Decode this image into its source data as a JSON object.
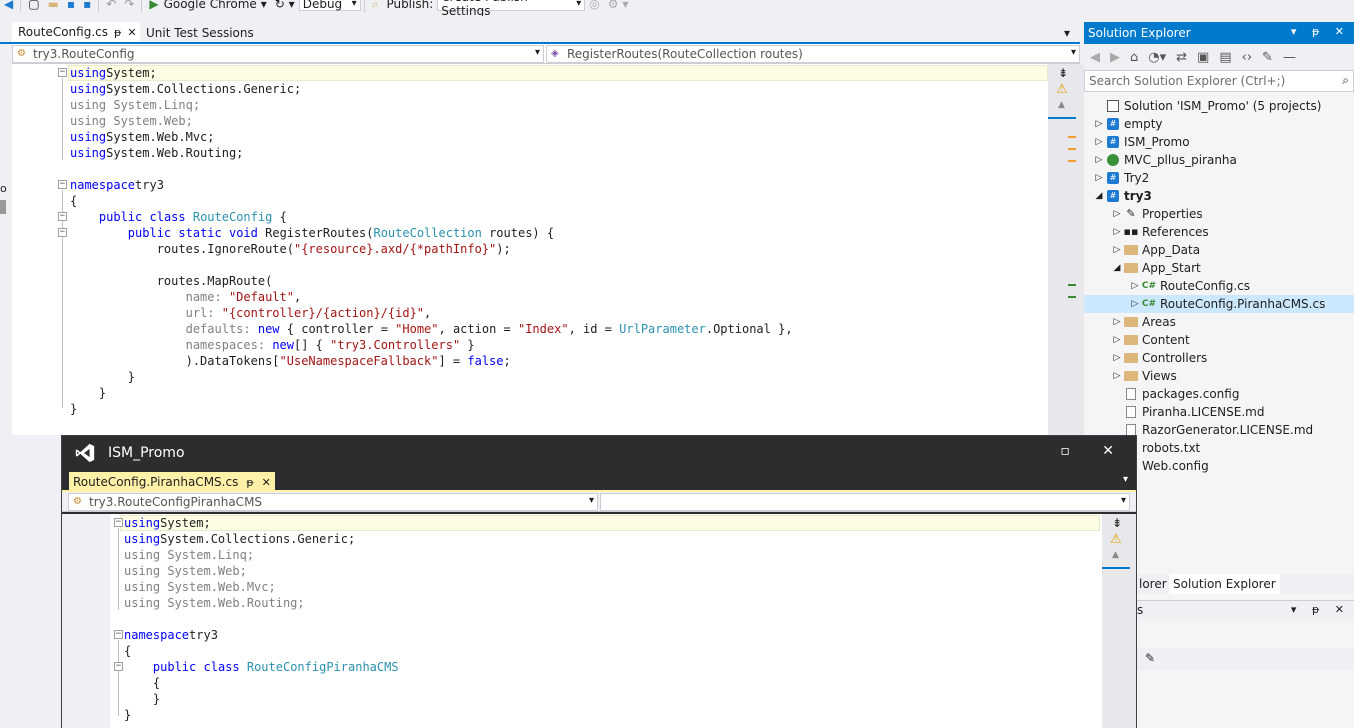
{
  "toolbar": {
    "run_target": "Google Chrome",
    "configuration": "Debug",
    "publish_label": "Publish:",
    "publish_setting": "Create Publish Settings"
  },
  "main_tabs": [
    {
      "label": "RouteConfig.cs",
      "active": true
    },
    {
      "label": "Unit Test Sessions",
      "active": false
    }
  ],
  "main_nav": {
    "class_combo": "try3.RouteConfig",
    "member_combo": "RegisterRoutes(RouteCollection routes)"
  },
  "main_code": [
    [
      [
        "kw",
        "using"
      ],
      [
        "",
        "System;"
      ]
    ],
    [
      [
        "kw",
        "using"
      ],
      [
        "",
        "System.Collections.Generic;"
      ]
    ],
    [
      [
        "gr",
        "using System.Linq;"
      ]
    ],
    [
      [
        "gr",
        "using System.Web;"
      ]
    ],
    [
      [
        "kw",
        "using"
      ],
      [
        "",
        "System.Web.Mvc;"
      ]
    ],
    [
      [
        "kw",
        "using"
      ],
      [
        "",
        "System.Web.Routing;"
      ]
    ],
    [],
    [
      [
        "kw",
        "namespace"
      ],
      [
        "",
        "try3"
      ]
    ],
    [
      [
        "",
        "{"
      ]
    ],
    [
      [
        "",
        "    "
      ],
      [
        "kw",
        "public"
      ],
      [
        "",
        " "
      ],
      [
        "kw",
        "class"
      ],
      [
        "",
        " "
      ],
      [
        "ty",
        "RouteConfig"
      ],
      [
        "",
        " {"
      ]
    ],
    [
      [
        "",
        "        "
      ],
      [
        "kw",
        "public"
      ],
      [
        "",
        " "
      ],
      [
        "kw",
        "static"
      ],
      [
        "",
        " "
      ],
      [
        "kw",
        "void"
      ],
      [
        "",
        " RegisterRoutes("
      ],
      [
        "ty",
        "RouteCollection"
      ],
      [
        "",
        " routes) {"
      ]
    ],
    [
      [
        "",
        "            routes.IgnoreRoute("
      ],
      [
        "str",
        "\"{resource}.axd/{*pathInfo}\""
      ],
      [
        "",
        ");"
      ]
    ],
    [],
    [
      [
        "",
        "            routes.MapRoute("
      ]
    ],
    [
      [
        "",
        "                "
      ],
      [
        "gr",
        "name:"
      ],
      [
        "",
        " "
      ],
      [
        "str",
        "\"Default\""
      ],
      [
        "",
        ","
      ]
    ],
    [
      [
        "",
        "                "
      ],
      [
        "gr",
        "url:"
      ],
      [
        "",
        " "
      ],
      [
        "str",
        "\"{controller}/{action}/{id}\""
      ],
      [
        "",
        ","
      ]
    ],
    [
      [
        "",
        "                "
      ],
      [
        "gr",
        "defaults:"
      ],
      [
        "",
        " "
      ],
      [
        "kw",
        "new"
      ],
      [
        "",
        " { controller = "
      ],
      [
        "str",
        "\"Home\""
      ],
      [
        "",
        ", action = "
      ],
      [
        "str",
        "\"Index\""
      ],
      [
        "",
        ", id = "
      ],
      [
        "ty",
        "UrlParameter"
      ],
      [
        "",
        ".Optional },"
      ]
    ],
    [
      [
        "",
        "                "
      ],
      [
        "gr",
        "namespaces:"
      ],
      [
        "",
        " "
      ],
      [
        "kw",
        "new"
      ],
      [
        "",
        "[] { "
      ],
      [
        "str",
        "\"try3.Controllers\""
      ],
      [
        "",
        " }"
      ]
    ],
    [
      [
        "",
        "                ).DataTokens["
      ],
      [
        "str",
        "\"UseNamespaceFallback\""
      ],
      [
        "",
        "] = "
      ],
      [
        "kw",
        "false"
      ],
      [
        "",
        ";"
      ]
    ],
    [
      [
        "",
        "        }"
      ]
    ],
    [
      [
        "",
        "    }"
      ]
    ],
    [
      [
        "",
        "}"
      ]
    ]
  ],
  "solution_explorer": {
    "title": "Solution Explorer",
    "search_placeholder": "Search Solution Explorer (Ctrl+;)",
    "nodes": [
      {
        "label": "Solution 'ISM_Promo' (5 projects)",
        "icon": "solution",
        "depth": 0,
        "exp": ""
      },
      {
        "label": "empty",
        "icon": "proj",
        "depth": 0,
        "exp": "▷"
      },
      {
        "label": "ISM_Promo",
        "icon": "proj",
        "depth": 0,
        "exp": "▷"
      },
      {
        "label": "MVC_pllus_piranha",
        "icon": "web",
        "depth": 0,
        "exp": "▷"
      },
      {
        "label": "Try2",
        "icon": "proj",
        "depth": 0,
        "exp": "▷"
      },
      {
        "label": "try3",
        "icon": "proj",
        "depth": 0,
        "exp": "◢",
        "bold": true
      },
      {
        "label": "Properties",
        "icon": "wrench",
        "depth": 1,
        "exp": "▷"
      },
      {
        "label": "References",
        "icon": "refs",
        "depth": 1,
        "exp": "▷"
      },
      {
        "label": "App_Data",
        "icon": "folder",
        "depth": 1,
        "exp": "▷"
      },
      {
        "label": "App_Start",
        "icon": "folder",
        "depth": 1,
        "exp": "◢"
      },
      {
        "label": "RouteConfig.cs",
        "icon": "cs",
        "depth": 2,
        "exp": "▷"
      },
      {
        "label": "RouteConfig.PiranhaCMS.cs",
        "icon": "cs",
        "depth": 2,
        "exp": "▷",
        "selected": true
      },
      {
        "label": "Areas",
        "icon": "folder",
        "depth": 1,
        "exp": "▷"
      },
      {
        "label": "Content",
        "icon": "folder",
        "depth": 1,
        "exp": "▷"
      },
      {
        "label": "Controllers",
        "icon": "folder",
        "depth": 1,
        "exp": "▷"
      },
      {
        "label": "Views",
        "icon": "folder",
        "depth": 1,
        "exp": "▷"
      },
      {
        "label": "packages.config",
        "icon": "file",
        "depth": 1,
        "exp": ""
      },
      {
        "label": "Piranha.LICENSE.md",
        "icon": "file",
        "depth": 1,
        "exp": ""
      },
      {
        "label": "RazorGenerator.LICENSE.md",
        "icon": "file",
        "depth": 1,
        "exp": ""
      },
      {
        "label": "robots.txt",
        "icon": "file",
        "depth": 1,
        "exp": ""
      },
      {
        "label": "Web.config",
        "icon": "file",
        "depth": 1,
        "exp": ""
      }
    ],
    "bottom_tabs": [
      {
        "label": "lorer",
        "active": false
      },
      {
        "label": "Solution Explorer",
        "active": true
      }
    ],
    "bottom_panel_title": "s"
  },
  "floating": {
    "title": "ISM_Promo",
    "tab_label": "RouteConfig.PiranhaCMS.cs",
    "class_combo": "try3.RouteConfigPiranhaCMS",
    "member_combo": "",
    "code": [
      [
        [
          "kw",
          "using"
        ],
        [
          "",
          "System;"
        ]
      ],
      [
        [
          "kw",
          "using"
        ],
        [
          "",
          "System.Collections.Generic;"
        ]
      ],
      [
        [
          "gr",
          "using System.Linq;"
        ]
      ],
      [
        [
          "gr",
          "using System.Web;"
        ]
      ],
      [
        [
          "gr",
          "using System.Web.Mvc;"
        ]
      ],
      [
        [
          "gr",
          "using System.Web.Routing;"
        ]
      ],
      [],
      [
        [
          "kw",
          "namespace"
        ],
        [
          "",
          "try3"
        ]
      ],
      [
        [
          "",
          "{"
        ]
      ],
      [
        [
          "",
          "    "
        ],
        [
          "kw",
          "public"
        ],
        [
          "",
          " "
        ],
        [
          "kw",
          "class"
        ],
        [
          "",
          " "
        ],
        [
          "ty",
          "RouteConfigPiranhaCMS"
        ]
      ],
      [
        [
          "",
          "    {"
        ]
      ],
      [
        [
          "",
          "    }"
        ]
      ],
      [
        [
          "",
          "}"
        ]
      ]
    ]
  },
  "colors": {
    "accent": "#007acc",
    "keyword": "#0000ff",
    "type": "#2b91af",
    "string": "#a31515",
    "active_float_tab": "#fff1a8"
  }
}
